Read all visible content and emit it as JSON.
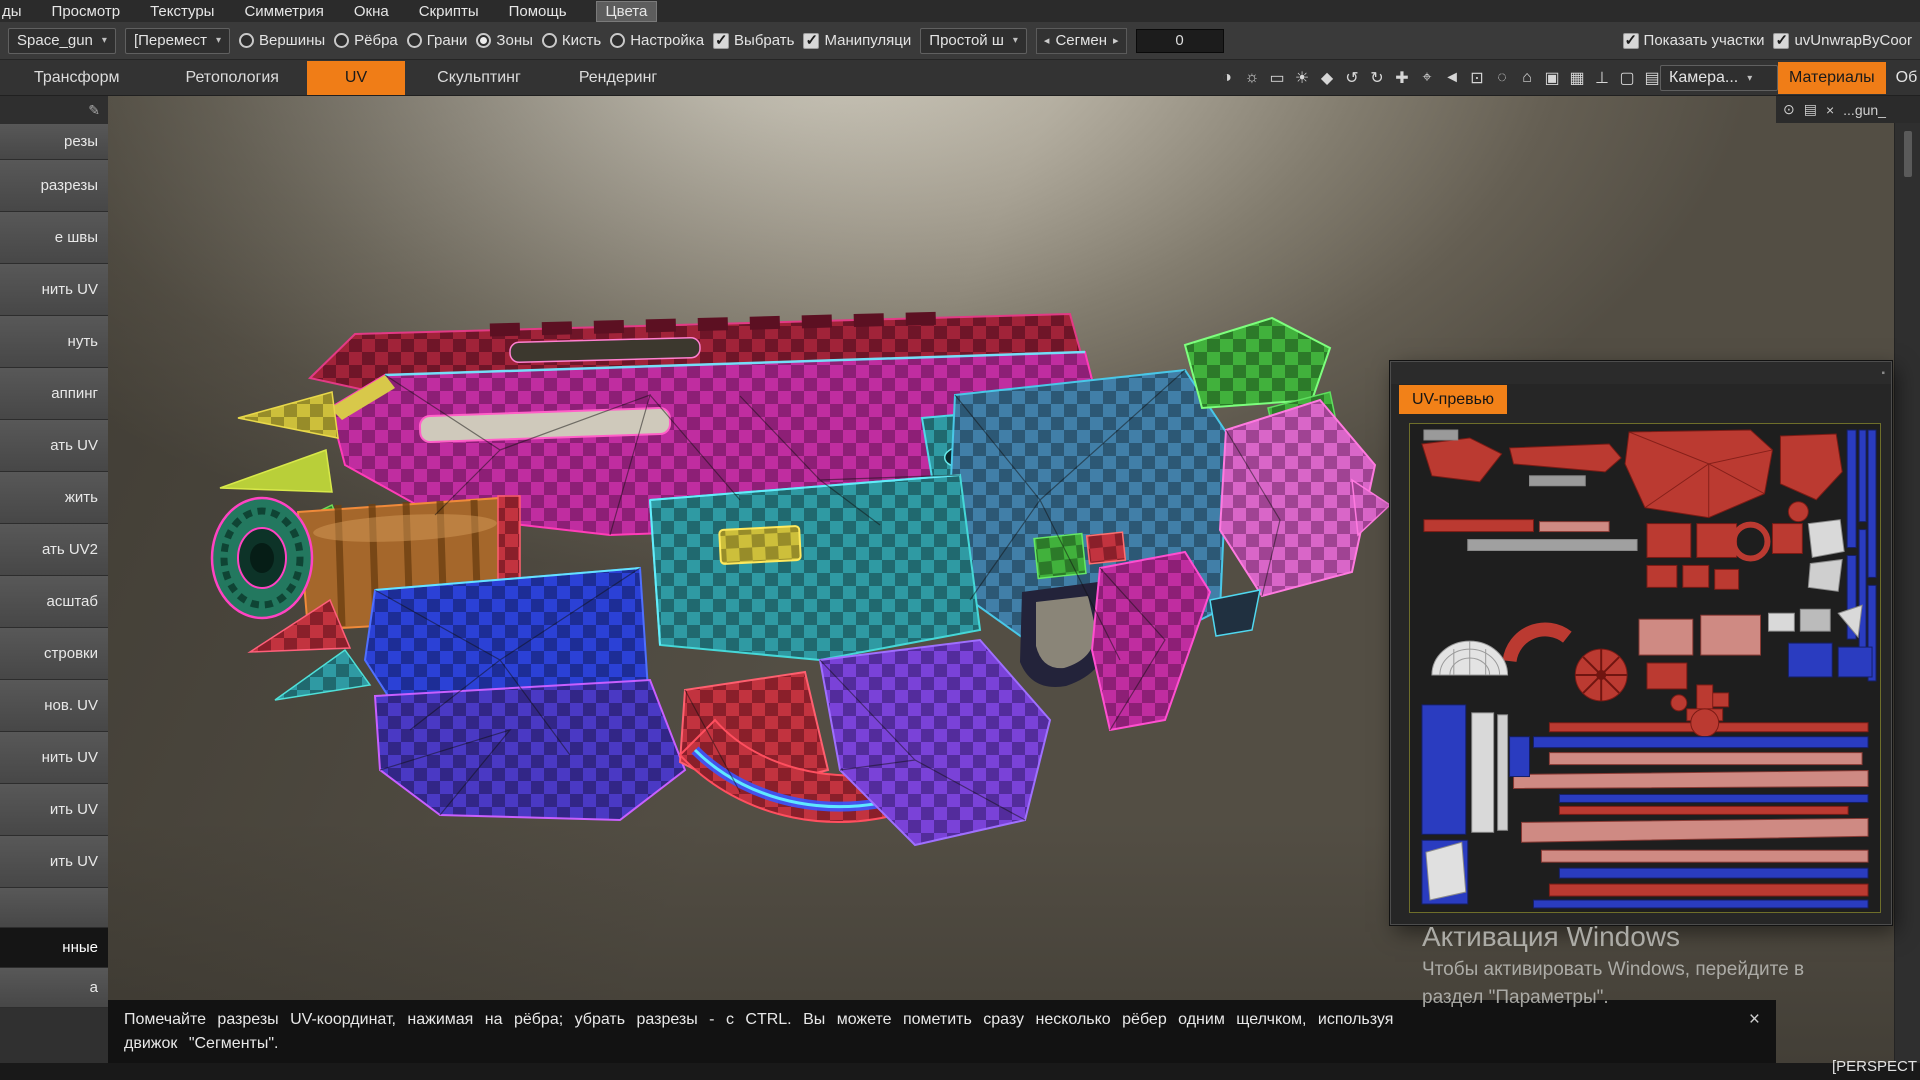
{
  "colors": {
    "accent_orange": "#f07d17",
    "viewport_glow": "#e0dccf",
    "status_bg": "#121212"
  },
  "menu": {
    "items": [
      {
        "label": "ды"
      },
      {
        "label": "Просмотр"
      },
      {
        "label": "Текстуры"
      },
      {
        "label": "Симметрия"
      },
      {
        "label": "Окна"
      },
      {
        "label": "Скрипты"
      },
      {
        "label": "Помощь"
      },
      {
        "label": "Цвета",
        "highlighted": true
      }
    ]
  },
  "toolbar": {
    "preset_combo": {
      "value": "Space_gun"
    },
    "tool_combo": {
      "value": "[Перемест"
    },
    "radios": [
      {
        "label": "Вершины",
        "selected": false
      },
      {
        "label": "Рёбра",
        "selected": false
      },
      {
        "label": "Грани",
        "selected": false
      },
      {
        "label": "Зоны",
        "selected": true
      },
      {
        "label": "Кисть",
        "selected": false
      },
      {
        "label": "Настройка",
        "selected": false
      }
    ],
    "select_checkbox": {
      "label": "Выбрать",
      "checked": true
    },
    "manip_checkbox": {
      "label": "Манипуляци",
      "checked": true
    },
    "seam_combo": {
      "value": "Простой ш"
    },
    "segment_spinner": {
      "label": "Сегмен",
      "prev": "◂",
      "next": "▸"
    },
    "segment_value": "0",
    "patches_checkbox": {
      "label": "Показать участки",
      "checked": true
    },
    "extra_checkbox": {
      "checked": true
    },
    "script_label": "uvUnwrapByCoor"
  },
  "rooms": {
    "tabs": [
      {
        "label": "Трансформ",
        "active": false
      },
      {
        "label": "Ретопология",
        "active": false
      },
      {
        "label": "UV",
        "active": true
      },
      {
        "label": "Скульптинг",
        "active": false
      },
      {
        "label": "Рендеринг",
        "active": false
      }
    ]
  },
  "view_icons": [
    {
      "name": "contrast-icon",
      "glyph": "◑"
    },
    {
      "name": "brightness-icon",
      "glyph": "☼"
    },
    {
      "name": "marquee-icon",
      "glyph": "▭"
    },
    {
      "name": "sun-icon",
      "glyph": "☀"
    },
    {
      "name": "droplet-icon",
      "glyph": "◆"
    },
    {
      "name": "rotate-ccw-icon",
      "glyph": "↺"
    },
    {
      "name": "rotate-cw-icon",
      "glyph": "↻"
    },
    {
      "name": "pan-icon",
      "glyph": "✚"
    },
    {
      "name": "target-icon",
      "glyph": "⌖"
    },
    {
      "name": "select-arrow-icon",
      "glyph": "◄"
    },
    {
      "name": "crop-icon",
      "glyph": "⊡"
    },
    {
      "name": "lasso-icon",
      "glyph": "◌"
    },
    {
      "name": "home-icon",
      "glyph": "⌂"
    },
    {
      "name": "cube-icon",
      "glyph": "▣"
    },
    {
      "name": "grid-icon",
      "glyph": "▦"
    },
    {
      "name": "axis-icon",
      "glyph": "⊥"
    },
    {
      "name": "frame-icon",
      "glyph": "▢"
    },
    {
      "name": "image-icon",
      "glyph": "▤"
    }
  ],
  "camera_combo": {
    "value": "Камера..."
  },
  "right_tabs": [
    {
      "label": "Материалы",
      "active": true
    },
    {
      "label": "Об",
      "active": false
    }
  ],
  "layer_strip": {
    "eye": "⊙",
    "texture": "▤",
    "close": "×",
    "name": "...gun_"
  },
  "sidebar": {
    "pencil": "✎",
    "items": [
      {
        "label": "резы",
        "selected": false
      },
      {
        "label": "разрезы",
        "selected": false
      },
      {
        "label": "е швы",
        "selected": false
      },
      {
        "label": "нить UV",
        "selected": false
      },
      {
        "label": "нуть",
        "selected": false
      },
      {
        "label": "аппинг",
        "selected": false
      },
      {
        "label": "ать UV",
        "selected": false
      },
      {
        "label": "жить",
        "selected": false
      },
      {
        "label": "ать UV2",
        "selected": false
      },
      {
        "label": "асштаб",
        "selected": false
      },
      {
        "label": "стровки",
        "selected": false
      },
      {
        "label": "нов. UV",
        "selected": false
      },
      {
        "label": "нить UV",
        "selected": false
      },
      {
        "label": "ить UV",
        "selected": false
      },
      {
        "label": "ить UV",
        "selected": false
      },
      {
        "label": "",
        "selected": false
      },
      {
        "label": "нные",
        "selected": true
      },
      {
        "label": "а",
        "selected": false
      }
    ]
  },
  "uv_preview": {
    "title": "UV-превью",
    "corner": "▪"
  },
  "status_bar": {
    "line1": "Помечайте разрезы UV-координат, нажимая на рёбра; убрать разрезы - с CTRL. Вы можете пометить сразу несколько рёбер одним щелчком, используя",
    "line2": "движок \"Сегменты\".",
    "close": "×"
  },
  "watermark": {
    "title": "Активация Windows",
    "line1": "Чтобы активировать Windows, перейдите в",
    "line2": "раздел \"Параметры\"."
  },
  "viewport": {
    "perspective_label": "[PERSPECT"
  }
}
